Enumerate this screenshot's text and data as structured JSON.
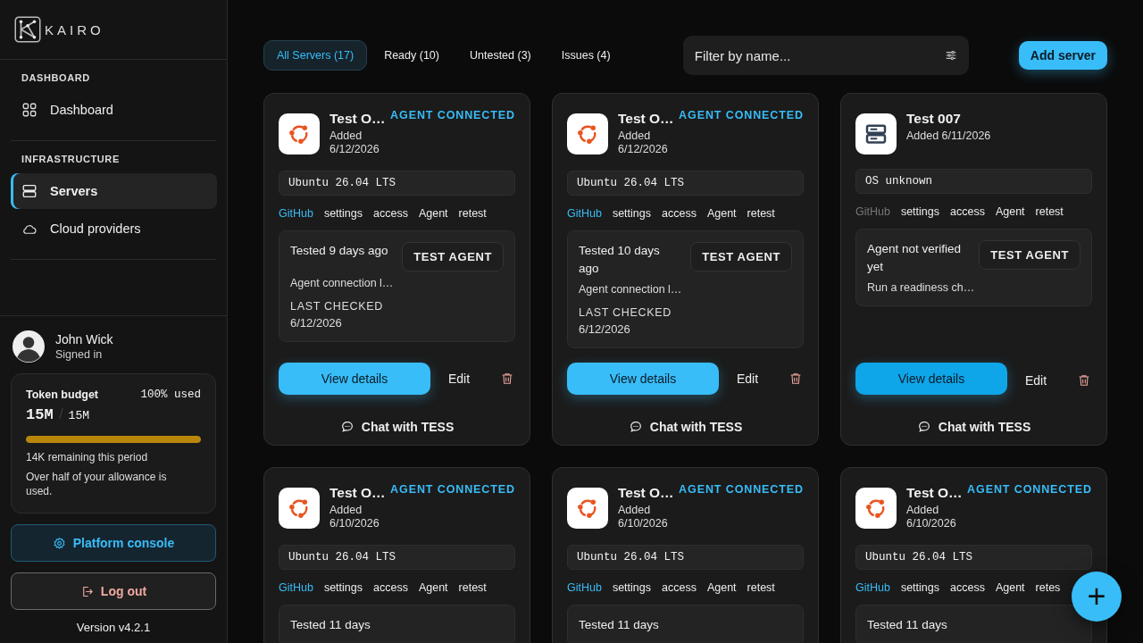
{
  "sidebar": {
    "logo": "KAIRO",
    "sections": [
      {
        "title": "DASHBOARD",
        "items": [
          {
            "label": "Dashboard",
            "kind": "grid",
            "selected": false
          }
        ]
      },
      {
        "title": "INFRASTRUCTURE",
        "items": [
          {
            "label": "Servers",
            "kind": "server",
            "selected": true
          },
          {
            "label": "Cloud providers",
            "kind": "cloud",
            "selected": false
          }
        ]
      }
    ],
    "user": {
      "name": "John Wick",
      "status": "Signed in"
    },
    "budget": {
      "title": "Token budget",
      "percent": "100%",
      "used_label": "used",
      "used": "15M",
      "total": "15M",
      "level": 1.0,
      "remaining": "14K remaining this period",
      "note": "Over half of your allowance is used."
    },
    "console_button": "Platform console",
    "logout_button": "Log out",
    "version": "Version v4.2.1"
  },
  "toolbar": {
    "tabs": [
      {
        "label": "All Servers (17)",
        "selected": true
      },
      {
        "label": "Ready (10)",
        "selected": false
      },
      {
        "label": "Untested (3)",
        "selected": false
      },
      {
        "label": "Issues (4)",
        "selected": false
      }
    ],
    "search": {
      "placeholder": "Filter by name..."
    },
    "add_button": "Add server"
  },
  "servers": [
    {
      "kind": "ubuntu",
      "name": "Test O…",
      "added": "Added 6/12/2026",
      "badge": "AGENT CONNECTED",
      "os": "Ubuntu 26.04 LTS",
      "github_linked": true,
      "links": [
        "GitHub",
        "settings",
        "access",
        "Agent",
        "retest"
      ],
      "test": {
        "status": "Tested 9 days ago",
        "note": "Agent connection l…",
        "button": "TEST AGENT",
        "last_label": "LAST CHECKED",
        "last_date": "6/12/2026"
      },
      "view_button": "View details",
      "focused": false,
      "edit_button": "Edit",
      "chat": "Chat with TESS"
    },
    {
      "kind": "ubuntu",
      "name": "Test O…",
      "added": "Added 6/12/2026",
      "badge": "AGENT CONNECTED",
      "os": "Ubuntu 26.04 LTS",
      "github_linked": true,
      "links": [
        "GitHub",
        "settings",
        "access",
        "Agent",
        "retest"
      ],
      "test": {
        "status": "Tested 10 days ago",
        "note": "Agent connection l…",
        "button": "TEST AGENT",
        "last_label": "LAST CHECKED",
        "last_date": "6/12/2026"
      },
      "view_button": "View details",
      "focused": false,
      "edit_button": "Edit",
      "chat": "Chat with TESS"
    },
    {
      "kind": "server",
      "name": "Test 007",
      "added": "Added 6/11/2026",
      "os": "OS unknown",
      "github_linked": false,
      "links": [
        "GitHub",
        "settings",
        "access",
        "Agent",
        "retest"
      ],
      "test": {
        "status": "Agent not verified yet",
        "note": "Run a readiness ch…",
        "button": "TEST AGENT"
      },
      "view_button": "View details",
      "focused": true,
      "edit_button": "Edit",
      "chat": "Chat with TESS"
    },
    {
      "kind": "ubuntu",
      "name": "Test O…",
      "added": "Added 6/10/2026",
      "badge": "AGENT CONNECTED",
      "os": "Ubuntu 26.04 LTS",
      "github_linked": true,
      "links": [
        "GitHub",
        "settings",
        "access",
        "Agent",
        "retest"
      ],
      "test": {
        "status": "Tested 11 days"
      }
    },
    {
      "kind": "ubuntu",
      "name": "Test O…",
      "added": "Added 6/10/2026",
      "badge": "AGENT CONNECTED",
      "os": "Ubuntu 26.04 LTS",
      "github_linked": true,
      "links": [
        "GitHub",
        "settings",
        "access",
        "Agent",
        "retest"
      ],
      "test": {
        "status": "Tested 11 days"
      }
    },
    {
      "kind": "ubuntu",
      "name": "Test O…",
      "added": "Added 6/10/2026",
      "badge": "AGENT CONNECTED",
      "os": "Ubuntu 26.04 LTS",
      "github_linked": true,
      "links": [
        "GitHub",
        "settings",
        "access",
        "Agent",
        "retes"
      ],
      "test": {
        "status": "Tested 11 days"
      }
    }
  ],
  "fab": "+"
}
